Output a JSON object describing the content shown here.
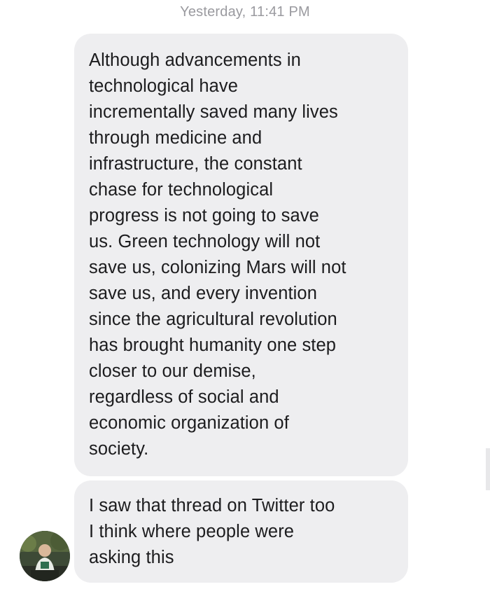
{
  "conversation": {
    "timestamp": "Yesterday, 11:41 PM",
    "messages": [
      {
        "text": "Although advancements in\ntechnological have\nincrementally saved many lives\nthrough medicine and\ninfrastructure, the constant\nchase for technological\nprogress is not going to save\nus. Green technology will not\nsave us, colonizing Mars will not\nsave us, and every invention\nsince the agricultural revolution\nhas brought humanity one step\ncloser to our demise,\nregardless of social and\neconomic organization of\nsociety."
      },
      {
        "text": "I saw that thread on Twitter too\nI think where people were\nasking this"
      }
    ]
  },
  "colors": {
    "bubble_background": "#eeeef0",
    "timestamp_text": "#9a9a9f",
    "message_text": "#1c1c1e"
  },
  "icons": {
    "avatar": "contact-avatar-photo"
  }
}
